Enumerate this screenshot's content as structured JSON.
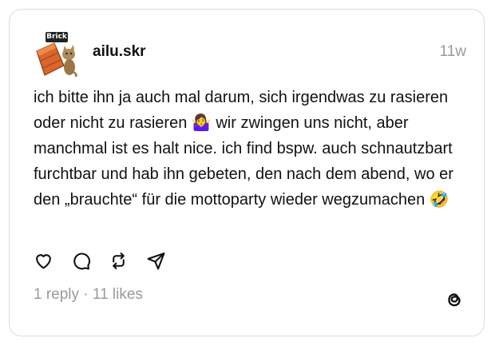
{
  "post": {
    "avatar_sticker_text": "Brick",
    "username": "ailu.skr",
    "timestamp": "11w",
    "text": "ich bitte ihn ja auch mal darum, sich irgendwas zu rasieren oder nicht zu rasieren 🤷‍♀️ wir zwingen uns nicht, aber manchmal ist es halt nice. ich find bspw. auch schnautzbart furchtbar und hab ihn gebeten, den nach dem abend, wo er den „brauchte“ für die mottoparty wieder wegzumachen 🤣",
    "stats": "1 reply · 11 likes"
  },
  "actions": [
    {
      "icon": "heart-icon",
      "label": "Like"
    },
    {
      "icon": "comment-icon",
      "label": "Reply"
    },
    {
      "icon": "repost-icon",
      "label": "Repost"
    },
    {
      "icon": "share-icon",
      "label": "Share"
    }
  ],
  "brand": {
    "icon": "threads-logo-icon"
  },
  "colors": {
    "text": "#111111",
    "muted": "#9a9a9a",
    "border": "#dcdcdc",
    "background": "#ffffff"
  }
}
